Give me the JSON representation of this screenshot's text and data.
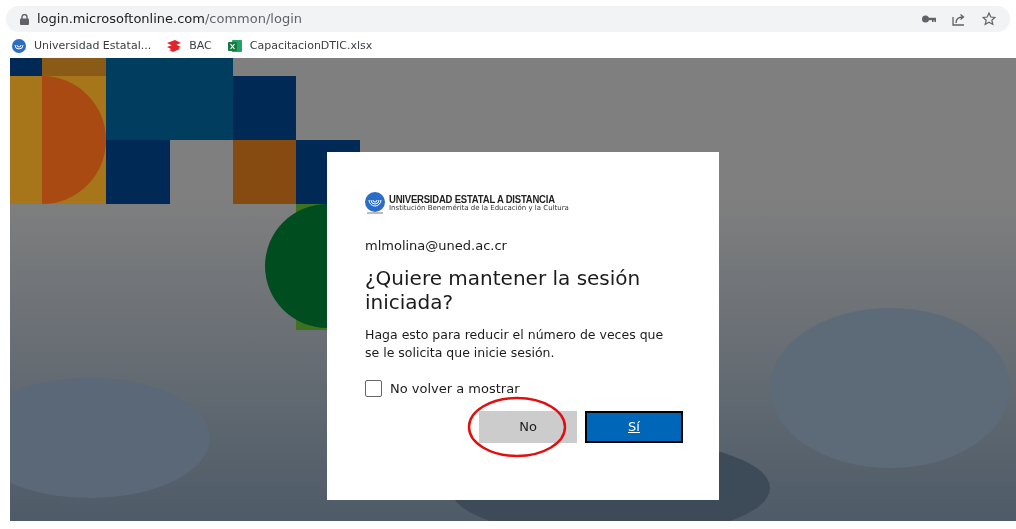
{
  "address_bar": {
    "host": "login.microsoftonline.com",
    "path": "/common/login"
  },
  "bookmarks": [
    {
      "label": "Universidad Estatal...",
      "kind": "university"
    },
    {
      "label": "BAC",
      "kind": "bank"
    },
    {
      "label": "CapacitacionDTIC.xlsx",
      "kind": "spreadsheet"
    }
  ],
  "dialog": {
    "logo_title": "UNIVERSIDAD ESTATAL A DISTANCIA",
    "logo_subtitle": "Institución Benemérita de la Educación y la Cultura",
    "account": "mlmolina@uned.ac.cr",
    "title": "¿Quiere mantener la sesión iniciada?",
    "description": "Haga esto para reducir el número de veces que se le solicita que inicie sesión.",
    "checkbox": {
      "label": "No volver a mostrar",
      "checked": false
    },
    "buttons": [
      {
        "label": "No",
        "kind": "secondary",
        "circled": true
      },
      {
        "label": "Sí",
        "kind": "primary",
        "circled": false
      }
    ]
  }
}
